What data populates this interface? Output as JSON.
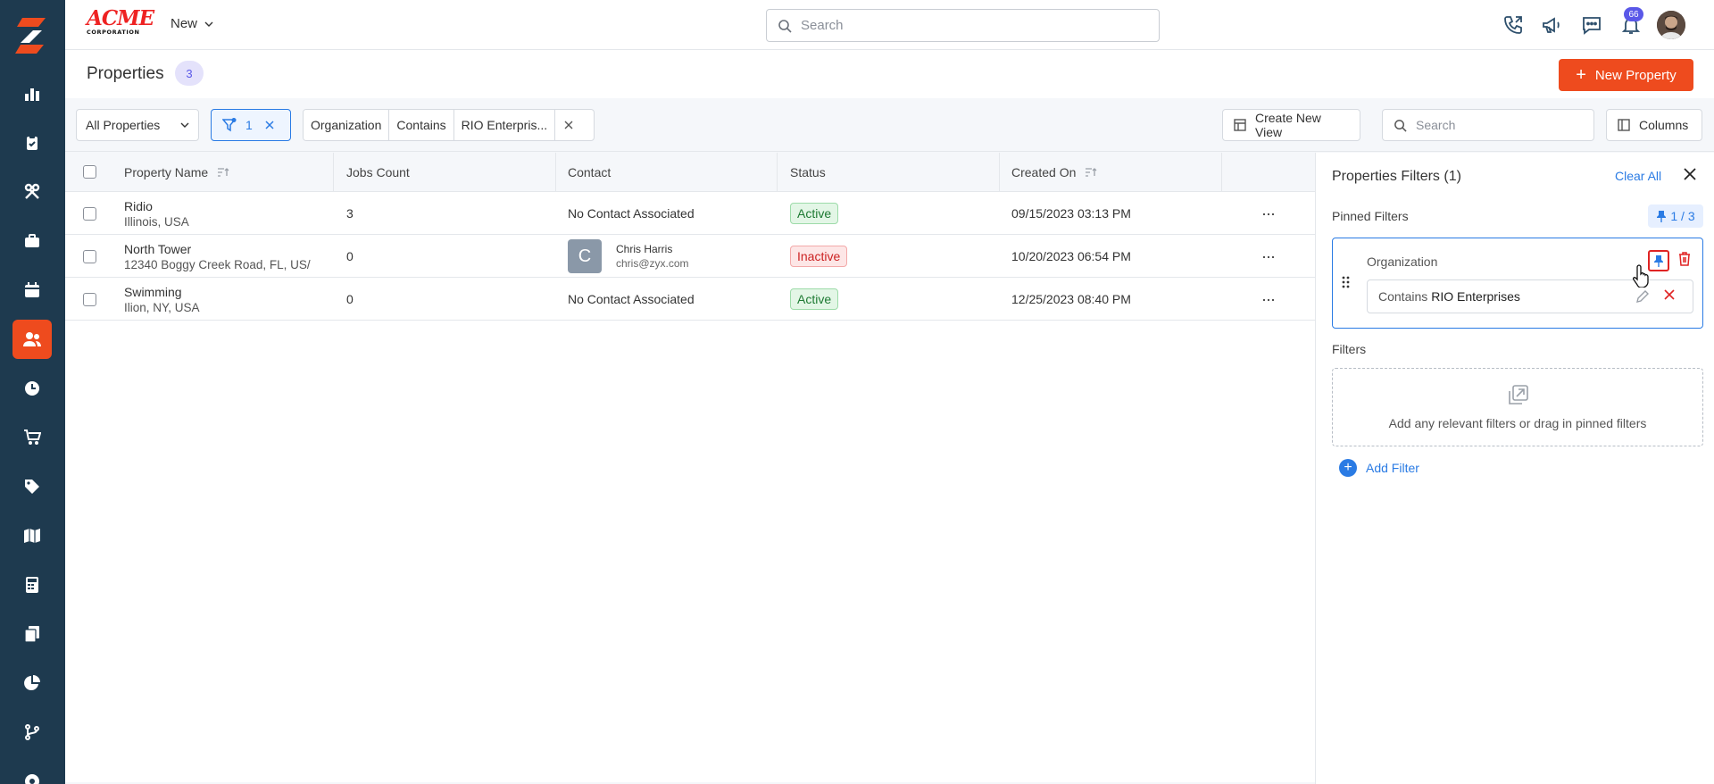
{
  "brand": {
    "logo_line1": "ACME",
    "logo_line2": "CORPORATION"
  },
  "sidebar": {
    "items": [
      {
        "icon": "chart-bar-icon"
      },
      {
        "icon": "clipboard-icon"
      },
      {
        "icon": "tools-icon"
      },
      {
        "icon": "briefcase-icon"
      },
      {
        "icon": "calendar-icon"
      },
      {
        "icon": "users-icon",
        "active": true
      },
      {
        "icon": "clock-icon"
      },
      {
        "icon": "cart-icon"
      },
      {
        "icon": "tag-icon"
      },
      {
        "icon": "map-icon"
      },
      {
        "icon": "calculator-icon"
      },
      {
        "icon": "documents-icon"
      },
      {
        "icon": "pie-chart-icon"
      },
      {
        "icon": "branch-icon"
      },
      {
        "icon": "gear-icon"
      }
    ]
  },
  "topbar": {
    "new_label": "New",
    "search_placeholder": "Search",
    "notification_count": "66"
  },
  "page": {
    "title": "Properties",
    "count": "3",
    "new_button": "New Property"
  },
  "filterbar": {
    "view_select": "All Properties",
    "filter_count": "1",
    "chip": {
      "field": "Organization",
      "operator": "Contains",
      "value": "RIO Enterpris..."
    },
    "create_view": "Create New View",
    "search_placeholder": "Search",
    "columns": "Columns"
  },
  "table": {
    "headers": {
      "property_name": "Property Name",
      "jobs_count": "Jobs Count",
      "contact": "Contact",
      "status": "Status",
      "created_on": "Created On"
    },
    "rows": [
      {
        "name": "Ridio",
        "address": "Illinois, USA",
        "jobs": "3",
        "contact_text": "No Contact Associated",
        "status": "Active",
        "created": "09/15/2023 03:13 PM"
      },
      {
        "name": "North Tower",
        "address": "12340 Boggy Creek Road, FL, US/",
        "jobs": "0",
        "contact_initial": "C",
        "contact_name": "Chris Harris",
        "contact_email": "chris@zyx.com",
        "status": "Inactive",
        "created": "10/20/2023 06:54 PM"
      },
      {
        "name": "Swimming",
        "address": "Ilion, NY, USA",
        "jobs": "0",
        "contact_text": "No Contact Associated",
        "status": "Active",
        "created": "12/25/2023 08:40 PM"
      }
    ],
    "row_menu": "···"
  },
  "panel": {
    "title": "Properties Filters (1)",
    "clear_all": "Clear All",
    "pinned_label": "Pinned Filters",
    "pin_count": "1 / 3",
    "pinned_filter": {
      "field": "Organization",
      "value_prefix": "Contains",
      "value": "RIO Enterprises"
    },
    "filters_label": "Filters",
    "drop_hint": "Add any relevant filters or drag in pinned filters",
    "add_filter": "Add Filter"
  },
  "colors": {
    "brand_orange": "#ee4b1e",
    "sidebar_bg": "#1e3a4f",
    "link_blue": "#2a7be4",
    "badge_purple": "#5a58e8"
  }
}
